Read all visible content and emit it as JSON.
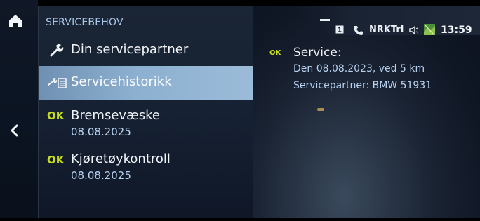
{
  "menu": {
    "title": "SERVICEBEHOV",
    "items": [
      {
        "label": "Din servicepartner",
        "icon": "wrench-icon"
      },
      {
        "label": "Servicehistorikk",
        "icon": "service-book-icon",
        "selected": true
      },
      {
        "status": "OK",
        "label": "Bremsevæske",
        "date": "08.08.2025"
      },
      {
        "status": "OK",
        "label": "Kjøretøykontroll",
        "date": "08.08.2025"
      }
    ]
  },
  "statusbar": {
    "station": "NRKTrl",
    "time": "13:59",
    "sim_badge": "1"
  },
  "detail": {
    "status": "OK",
    "title": "Service:",
    "date_line": "Den 08.08.2023, ved 5 km",
    "partner_line": "Servicepartner: BMW 51931"
  },
  "colors": {
    "accent_ok": "#c8dc1e",
    "selected_row": "#8db0d0",
    "subtext": "#b7d1f0"
  }
}
